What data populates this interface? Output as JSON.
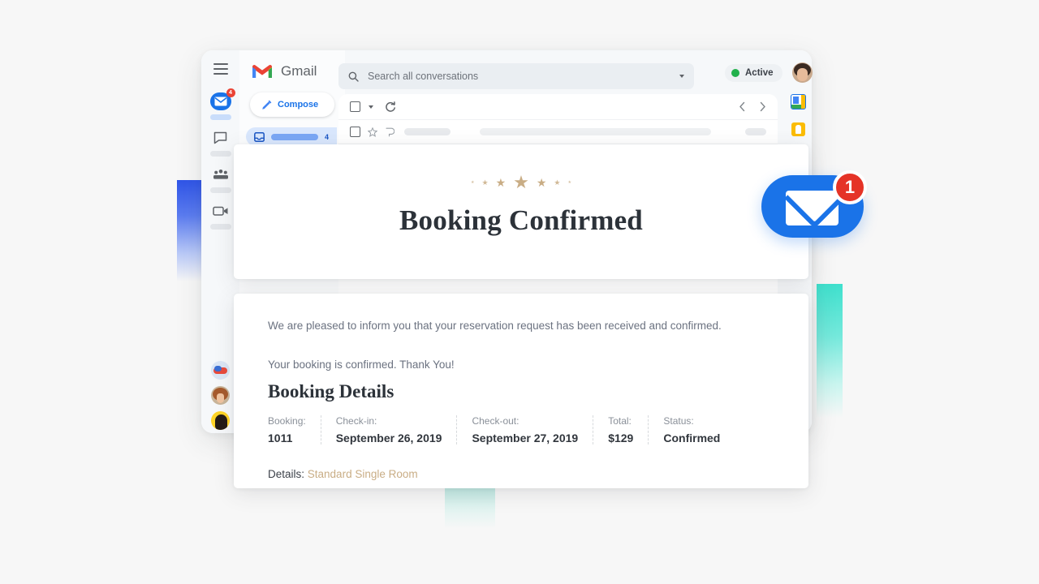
{
  "app": {
    "brand": "Gmail",
    "menu_icon": "hamburger-icon",
    "search": {
      "placeholder": "Search all conversations",
      "icon": "search-icon",
      "dropdown_icon": "chevron-down-icon"
    },
    "status_chip": {
      "label": "Active",
      "dot_color": "#22b14c"
    },
    "avatar": "user-avatar"
  },
  "rail": {
    "items": [
      {
        "name": "mail",
        "icon": "mail-icon",
        "badge": "4",
        "active": true
      },
      {
        "name": "chat",
        "icon": "chat-bubble-icon",
        "badge": "",
        "active": false
      },
      {
        "name": "spaces",
        "icon": "spaces-icon",
        "badge": "",
        "active": false
      },
      {
        "name": "meet",
        "icon": "video-camera-icon",
        "badge": "",
        "active": false
      }
    ],
    "contacts": [
      "contact-avatar-1",
      "contact-avatar-2",
      "contact-avatar-3"
    ]
  },
  "nav": {
    "compose_label": "Compose",
    "inbox_count": "4"
  },
  "toolbar": {
    "select_all_icon": "checkbox-icon",
    "select_all_caret": "chevron-down-icon",
    "refresh_icon": "refresh-icon",
    "prev_icon": "chevron-left-icon",
    "next_icon": "chevron-right-icon"
  },
  "mail_row": {
    "checkbox_icon": "checkbox-icon",
    "star_icon": "star-outline-icon",
    "important_icon": "important-marker-icon"
  },
  "right_rail": {
    "items": [
      {
        "name": "google-calendar",
        "icon": "calendar-icon"
      },
      {
        "name": "google-keep",
        "icon": "keep-icon"
      }
    ]
  },
  "email": {
    "stars_decoration": [
      0,
      1,
      2,
      3,
      2,
      1,
      0
    ],
    "title": "Booking Confirmed",
    "intro": "We are pleased to inform you that your reservation request has been received and confirmed.",
    "thanks": "Your booking is confirmed. Thank You!",
    "details_heading": "Booking Details",
    "details": [
      {
        "label": "Booking:",
        "value": "1011"
      },
      {
        "label": "Check-in:",
        "value": "September 26, 2019"
      },
      {
        "label": "Check-out:",
        "value": "September 27, 2019"
      },
      {
        "label": "Total:",
        "value": "$129"
      },
      {
        "label": "Status:",
        "value": "Confirmed"
      }
    ],
    "footer_label": "Details:",
    "footer_value": "Standard Single Room",
    "accent_color": "#c9ad85"
  },
  "notification": {
    "icon": "envelope-icon",
    "count": "1",
    "pill_color": "#1a73e8",
    "badge_color": "#e53327"
  }
}
